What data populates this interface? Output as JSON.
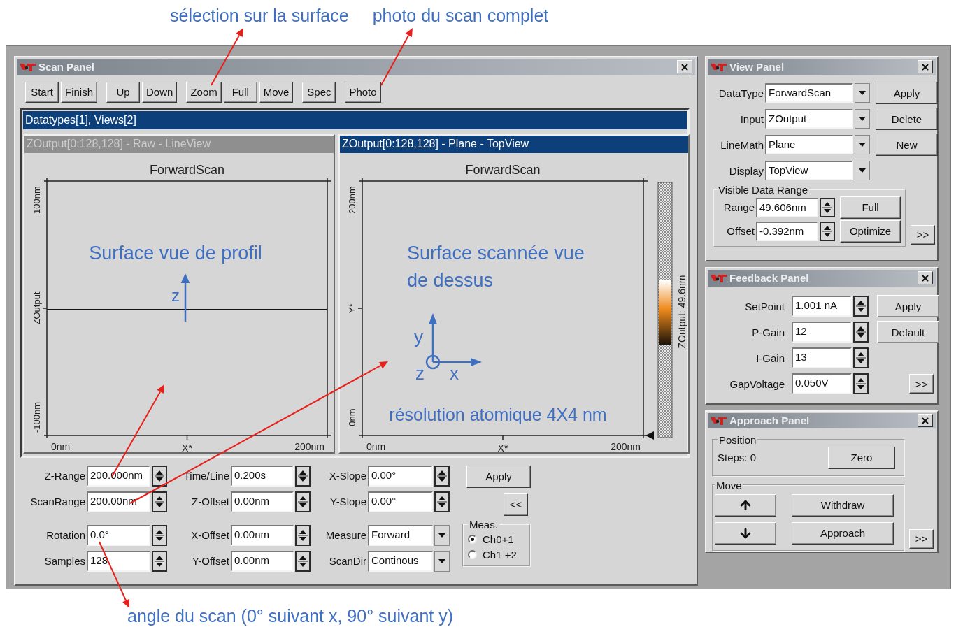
{
  "annotations": {
    "top": [
      "sélection sur la surface",
      "photo du scan complet"
    ],
    "bottom": "angle du scan (0° suivant x, 90° suivant y)"
  },
  "scan_panel": {
    "title": "Scan Panel",
    "toolbar": [
      [
        "Start",
        "Finish"
      ],
      [
        "Up",
        "Down"
      ],
      [
        "Zoom",
        "Full",
        "Move"
      ],
      [
        "Spec"
      ],
      [
        "Photo"
      ]
    ],
    "views_header": "Datatypes[1], Views[2]",
    "views": [
      {
        "kind": "line",
        "title": "ZOutput[0:128,128] - Raw - LineView",
        "selected": false,
        "plot_title": "ForwardScan",
        "y_ticks": [
          "100nm",
          "-100nm"
        ],
        "y_label": "ZOutput",
        "x_ticks": [
          "0nm",
          "200nm"
        ],
        "x_label": "X*",
        "note": "Surface vue de profil",
        "axes": [
          "z"
        ]
      },
      {
        "kind": "top",
        "title": "ZOutput[0:128,128] - Plane - TopView",
        "selected": true,
        "plot_title": "ForwardScan",
        "y_ticks": [
          "200nm",
          "0nm"
        ],
        "y_label": "Y*",
        "x_ticks": [
          "0nm",
          "200nm"
        ],
        "x_label": "X*",
        "note": "Surface scannée vue de dessus",
        "axes": [
          "y",
          "z",
          "x"
        ],
        "footnote": "résolution atomique 4X4 nm",
        "colorbar_label": "ZOutput: 49.6nm"
      }
    ],
    "params": [
      [
        [
          {
            "label": "Z-Range",
            "value": "200.000nm",
            "kind": "spin"
          },
          {
            "label": "Time/Line",
            "value": "0.200s",
            "kind": "spin"
          },
          {
            "label": "X-Slope",
            "value": "0.00°",
            "kind": "spin"
          }
        ],
        [
          {
            "label": "ScanRange",
            "value": "200.00nm",
            "kind": "spin"
          },
          {
            "label": "Z-Offset",
            "value": "0.00nm",
            "kind": "spin"
          },
          {
            "label": "Y-Slope",
            "value": "0.00°",
            "kind": "spin"
          }
        ]
      ],
      [
        [
          {
            "label": "Rotation",
            "value": "0.0°",
            "kind": "spin"
          },
          {
            "label": "X-Offset",
            "value": "0.00nm",
            "kind": "spin"
          },
          {
            "label": "Measure",
            "value": "Forward",
            "kind": "combo"
          }
        ],
        [
          {
            "label": "Samples",
            "value": "128",
            "kind": "spin"
          },
          {
            "label": "Y-Offset",
            "value": "0.00nm",
            "kind": "spin"
          },
          {
            "label": "ScanDir",
            "value": "Continous",
            "kind": "combo"
          }
        ]
      ]
    ],
    "apply": "Apply",
    "collapse": "<<",
    "meas": {
      "title": "Meas.",
      "options": [
        {
          "label": "Ch0+1",
          "selected": true
        },
        {
          "label": "Ch1 +2",
          "selected": false
        }
      ]
    }
  },
  "view_panel": {
    "title": "View Panel",
    "rows": [
      {
        "label": "DataType",
        "value": "ForwardScan",
        "button": "Apply"
      },
      {
        "label": "Input",
        "value": "ZOutput",
        "button": "Delete"
      },
      {
        "label": "LineMath",
        "value": "Plane",
        "button": "New"
      },
      {
        "label": "Display",
        "value": "TopView"
      }
    ],
    "range_group": {
      "title": "Visible Data Range",
      "rows": [
        {
          "label": "Range",
          "value": "49.606nm",
          "button": "Full"
        },
        {
          "label": "Offset",
          "value": "-0.392nm",
          "button": "Optimize"
        }
      ]
    },
    "more": ">>"
  },
  "feedback_panel": {
    "title": "Feedback Panel",
    "rows": [
      {
        "label": "SetPoint",
        "value": "1.001 nA",
        "button": "Apply"
      },
      {
        "label": "P-Gain",
        "value": "12",
        "button": "Default"
      },
      {
        "label": "I-Gain",
        "value": "13"
      },
      {
        "label": "GapVoltage",
        "value": "0.050V"
      }
    ],
    "more": ">>"
  },
  "approach_panel": {
    "title": "Approach Panel",
    "position": {
      "title": "Position",
      "steps": "Steps: 0",
      "button": "Zero"
    },
    "move": {
      "title": "Move",
      "rows": [
        {
          "kind": "up",
          "button": "Withdraw"
        },
        {
          "kind": "down",
          "button": "Approach"
        }
      ]
    },
    "more": ">>"
  }
}
